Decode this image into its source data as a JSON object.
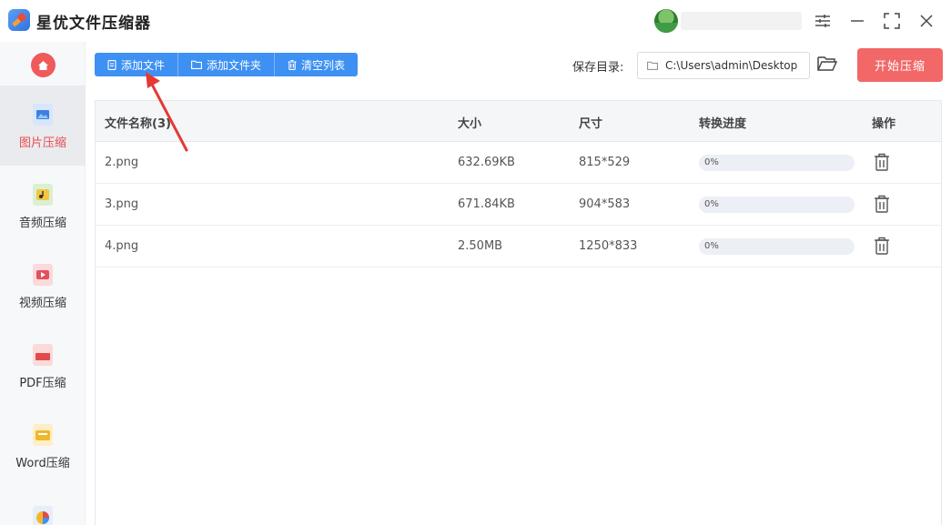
{
  "app": {
    "title": "星优文件压缩器"
  },
  "sidebar": {
    "items": [
      {
        "label": "图片压缩",
        "active": true
      },
      {
        "label": "音频压缩",
        "active": false
      },
      {
        "label": "视频压缩",
        "active": false
      },
      {
        "label": "PDF压缩",
        "active": false
      },
      {
        "label": "Word压缩",
        "active": false
      }
    ]
  },
  "toolbar": {
    "add_file": "添加文件",
    "add_folder": "添加文件夹",
    "clear_list": "清空列表",
    "save_label": "保存目录:",
    "save_path": "C:\\Users\\admin\\Desktop",
    "start": "开始压缩"
  },
  "table": {
    "headers": {
      "name": "文件名称(3)",
      "size": "大小",
      "dimensions": "尺寸",
      "progress": "转换进度",
      "action": "操作"
    },
    "rows": [
      {
        "name": "2.png",
        "size": "632.69KB",
        "dimensions": "815*529",
        "progress": "0%",
        "progress_value": 0
      },
      {
        "name": "3.png",
        "size": "671.84KB",
        "dimensions": "904*583",
        "progress": "0%",
        "progress_value": 0
      },
      {
        "name": "4.png",
        "size": "2.50MB",
        "dimensions": "1250*833",
        "progress": "0%",
        "progress_value": 0
      }
    ]
  },
  "colors": {
    "primary": "#3e91f3",
    "accent": "#f26767",
    "active_label": "#e84c4c"
  }
}
